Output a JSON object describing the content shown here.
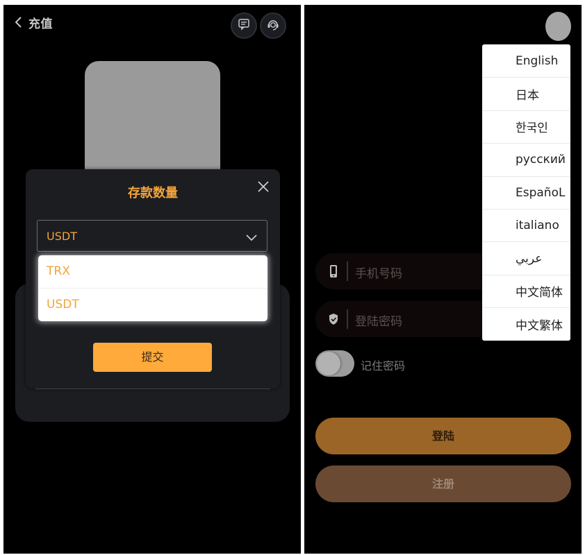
{
  "recharge_screen": {
    "header": {
      "title": "充值"
    },
    "modal": {
      "title": "存款数量",
      "select": {
        "value": "USDT"
      },
      "options": [
        "TRX",
        "USDT"
      ],
      "submit_label": "提交"
    }
  },
  "login_screen": {
    "languages": [
      "English",
      "日本",
      "한국인",
      "русский",
      "EspañoL",
      "italiano",
      "عربي",
      "中文简体",
      "中文繁体"
    ],
    "phone_field": {
      "placeholder": "手机号码"
    },
    "password_field": {
      "placeholder": "登陆密码"
    },
    "remember_label": "记住密码",
    "login_label": "登陆",
    "register_label": "注册"
  },
  "colors": {
    "accent": "#ffaa3b",
    "accent_text": "#f2a43a",
    "login_button": "#9a6526",
    "register_button": "#6b4a34",
    "background": "#000000",
    "card": "#1c1d21"
  },
  "icons": [
    "chevron-left-icon",
    "message-icon",
    "customer-service-icon",
    "close-icon",
    "chevron-down-icon",
    "phone-icon",
    "shield-icon"
  ]
}
